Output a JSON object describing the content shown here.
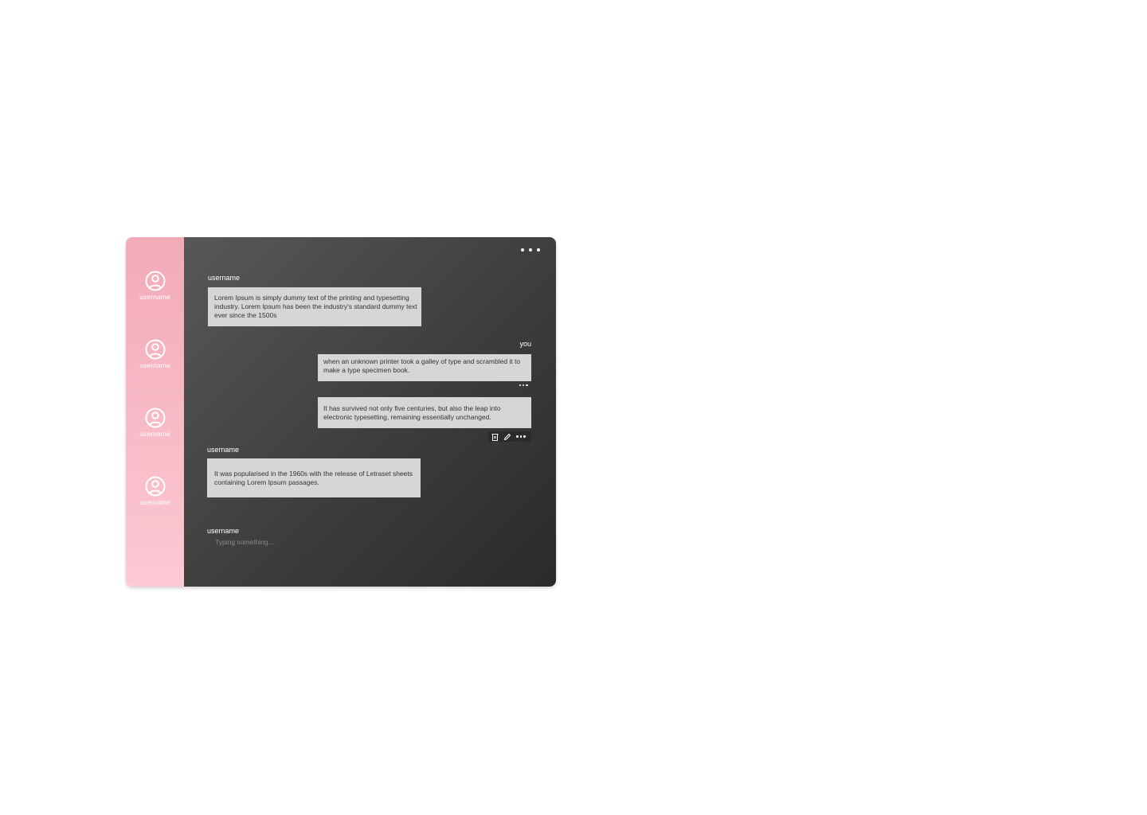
{
  "sidebar": {
    "users": [
      {
        "name": "username",
        "icon": "user-circle-icon"
      },
      {
        "name": "username",
        "icon": "user-circle-icon"
      },
      {
        "name": "username",
        "icon": "user-circle-icon"
      },
      {
        "name": "username",
        "icon": "user-circle-icon"
      }
    ]
  },
  "chat": {
    "menu_icon": "more-horizontal-icon",
    "messages": [
      {
        "sender": "username",
        "text": "Lorem Ipsum is simply dummy text of the printing and typesetting industry. Lorem Ipsum has been the industry's standard dummy text ever since the 1500s"
      },
      {
        "sender": "you",
        "text": "when an unknown printer took a galley of type and scrambled it to make a type specimen book."
      },
      {
        "sender": "",
        "text": "It has survived not only five centuries, but also the leap into electronic typesetting, remaining essentially unchanged."
      },
      {
        "sender": "username",
        "text": "It was popularised in the 1960s with the release of Letraset sheets containing Lorem Ipsum passages."
      }
    ],
    "message_actions": [
      "trash-icon",
      "pencil-icon",
      "more-horizontal-icon"
    ],
    "typing": {
      "sender": "username",
      "placeholder": "Typing something..."
    }
  },
  "colors": {
    "sidebar_top": "#f2aab7",
    "sidebar_bottom": "#fcc9d4",
    "chat_background": "#3d3d3d",
    "bubble": "#d6d6d6"
  }
}
